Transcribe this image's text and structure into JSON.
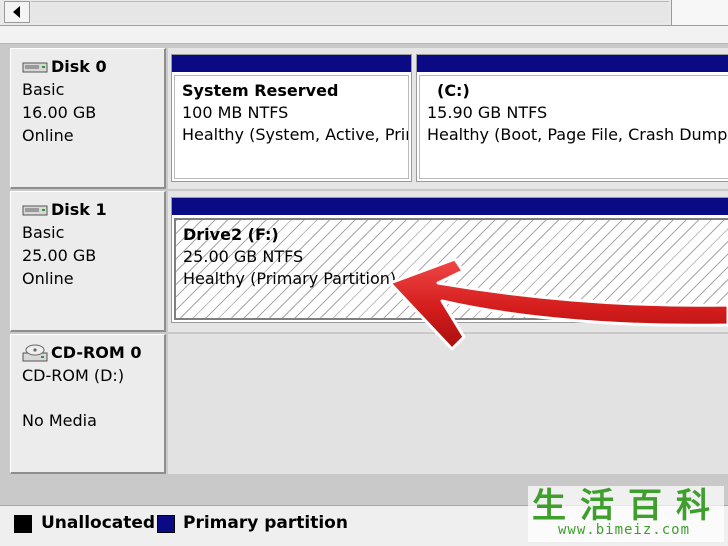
{
  "disks": [
    {
      "name": "Disk 0",
      "type": "Basic",
      "size": "16.00 GB",
      "status": "Online",
      "partitions": [
        {
          "title": "System Reserved",
          "info": "100 MB NTFS",
          "health": "Healthy (System, Active, Primary Partition)"
        },
        {
          "title": "(C:)",
          "info": "15.90 GB NTFS",
          "health": "Healthy (Boot, Page File, Crash Dump, Primary Partition)"
        }
      ]
    },
    {
      "name": "Disk 1",
      "type": "Basic",
      "size": "25.00 GB",
      "status": "Online",
      "partitions": [
        {
          "title": "Drive2  (F:)",
          "info": "25.00 GB NTFS",
          "health": "Healthy (Primary Partition)"
        }
      ]
    }
  ],
  "cdrom": {
    "name": "CD-ROM 0",
    "device": "CD-ROM (D:)",
    "media": "No Media"
  },
  "legend": {
    "unallocated": "Unallocated",
    "primary": "Primary partition",
    "unallocated_color": "#000000",
    "primary_color": "#0a0a85"
  },
  "watermark": {
    "chinese": "生活百科",
    "url": "www.bimeiz.com"
  },
  "icons": {
    "disk": "hard-disk-icon",
    "cdrom": "cd-drive-icon",
    "scroll_left": "arrow-left-icon",
    "pointer": "red-arrow-annotation"
  },
  "colors": {
    "partition_bar": "#0a0a85",
    "annotation_arrow": "#d41c1c"
  }
}
